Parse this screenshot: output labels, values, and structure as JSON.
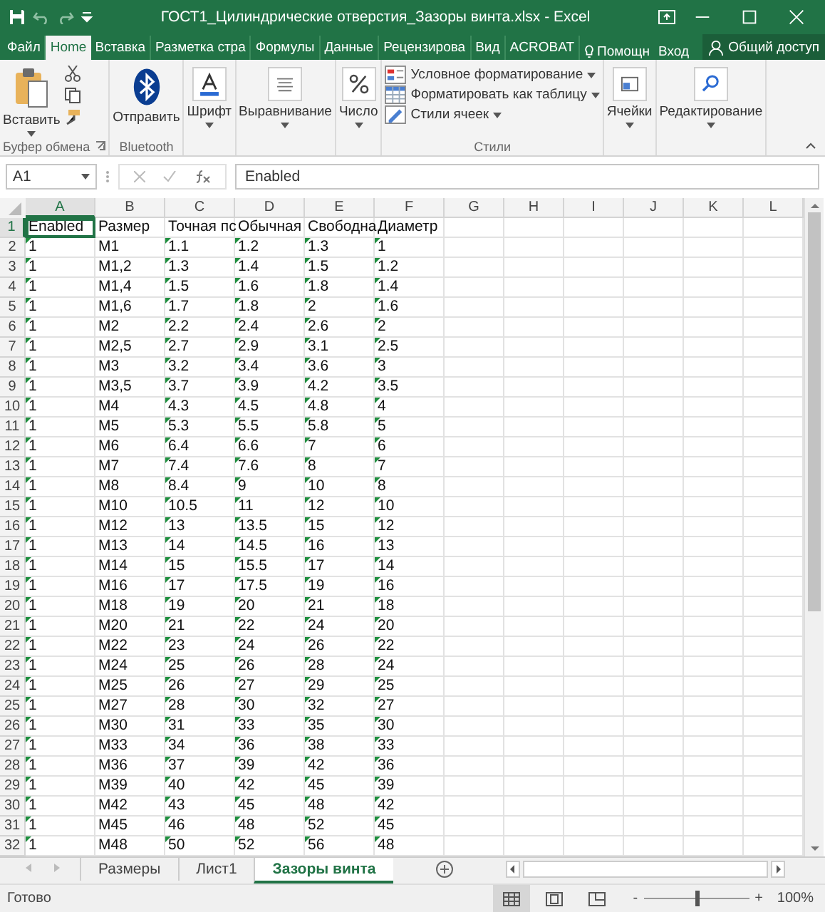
{
  "window": {
    "title": "ГОСТ1_Цилиндрические отверстия_Зазоры винта.xlsx - Excel"
  },
  "ribbon_tabs": [
    {
      "label": "Файл",
      "selected": false
    },
    {
      "label": "Home",
      "selected": true
    },
    {
      "label": "Вставка",
      "selected": false
    },
    {
      "label": "Разметка стра",
      "selected": false
    },
    {
      "label": "Формулы",
      "selected": false
    },
    {
      "label": "Данные",
      "selected": false
    },
    {
      "label": "Рецензирова",
      "selected": false
    },
    {
      "label": "Вид",
      "selected": false
    },
    {
      "label": "ACROBAT",
      "selected": false
    }
  ],
  "tell_me": "Помощн",
  "sign_in": "Вход",
  "share": "Общий доступ",
  "ribbon_groups": [
    {
      "kind": "clipboard",
      "label": "Буфер обмена",
      "buttons": [
        {
          "label": "Вставить",
          "dropdown": true
        }
      ]
    },
    {
      "kind": "bluetooth",
      "label": "Bluetooth",
      "buttons": [
        {
          "label": "Отправить",
          "dropdown": false
        }
      ]
    },
    {
      "kind": "font",
      "buttons": [
        {
          "label": "Шрифт",
          "dropdown": true
        }
      ]
    },
    {
      "kind": "alignment",
      "buttons": [
        {
          "label": "Выравнивание",
          "dropdown": true
        }
      ]
    },
    {
      "kind": "number",
      "buttons": [
        {
          "label": "Число",
          "dropdown": true
        }
      ]
    },
    {
      "kind": "styles",
      "label": "Стили",
      "buttons": [
        {
          "label": "Условное форматирование",
          "dropdown": true
        },
        {
          "label": "Форматировать как таблицу",
          "dropdown": true
        },
        {
          "label": "Стили ячеек",
          "dropdown": true
        }
      ]
    },
    {
      "kind": "cells",
      "buttons": [
        {
          "label": "Ячейки",
          "dropdown": true
        }
      ]
    },
    {
      "kind": "editing",
      "buttons": [
        {
          "label": "Редактирование",
          "dropdown": true
        }
      ]
    }
  ],
  "formula_bar": {
    "name_box": "A1",
    "formula": "Enabled"
  },
  "sheet": {
    "columns": [
      {
        "label": "A",
        "selected": true,
        "numeric_text": true
      },
      {
        "label": "B",
        "selected": false,
        "numeric_text": false
      },
      {
        "label": "C",
        "selected": false,
        "numeric_text": true
      },
      {
        "label": "D",
        "selected": false,
        "numeric_text": true
      },
      {
        "label": "E",
        "selected": false,
        "numeric_text": true
      },
      {
        "label": "F",
        "selected": false,
        "numeric_text": true
      },
      {
        "label": "G",
        "selected": false,
        "numeric_text": false
      },
      {
        "label": "H",
        "selected": false,
        "numeric_text": false
      },
      {
        "label": "I",
        "selected": false,
        "numeric_text": false
      },
      {
        "label": "J",
        "selected": false,
        "numeric_text": false
      },
      {
        "label": "K",
        "selected": false,
        "numeric_text": false
      },
      {
        "label": "L",
        "selected": false,
        "numeric_text": false
      }
    ],
    "rows": [
      {
        "number": "1",
        "selected": true,
        "flagged": false,
        "cells": [
          "Enabled",
          "Размер",
          "Точная пс",
          "Обычная",
          "Свободна",
          "Диаметр"
        ]
      },
      {
        "number": "2",
        "selected": false,
        "flagged": true,
        "cells": [
          "1",
          "M1",
          "1.1",
          "1.2",
          "1.3",
          "1"
        ]
      },
      {
        "number": "3",
        "selected": false,
        "flagged": true,
        "cells": [
          "1",
          "M1,2",
          "1.3",
          "1.4",
          "1.5",
          "1.2"
        ]
      },
      {
        "number": "4",
        "selected": false,
        "flagged": true,
        "cells": [
          "1",
          "M1,4",
          "1.5",
          "1.6",
          "1.8",
          "1.4"
        ]
      },
      {
        "number": "5",
        "selected": false,
        "flagged": true,
        "cells": [
          "1",
          "M1,6",
          "1.7",
          "1.8",
          "2",
          "1.6"
        ]
      },
      {
        "number": "6",
        "selected": false,
        "flagged": true,
        "cells": [
          "1",
          "M2",
          "2.2",
          "2.4",
          "2.6",
          "2"
        ]
      },
      {
        "number": "7",
        "selected": false,
        "flagged": true,
        "cells": [
          "1",
          "M2,5",
          "2.7",
          "2.9",
          "3.1",
          "2.5"
        ]
      },
      {
        "number": "8",
        "selected": false,
        "flagged": true,
        "cells": [
          "1",
          "M3",
          "3.2",
          "3.4",
          "3.6",
          "3"
        ]
      },
      {
        "number": "9",
        "selected": false,
        "flagged": true,
        "cells": [
          "1",
          "M3,5",
          "3.7",
          "3.9",
          "4.2",
          "3.5"
        ]
      },
      {
        "number": "10",
        "selected": false,
        "flagged": true,
        "cells": [
          "1",
          "M4",
          "4.3",
          "4.5",
          "4.8",
          "4"
        ]
      },
      {
        "number": "11",
        "selected": false,
        "flagged": true,
        "cells": [
          "1",
          "M5",
          "5.3",
          "5.5",
          "5.8",
          "5"
        ]
      },
      {
        "number": "12",
        "selected": false,
        "flagged": true,
        "cells": [
          "1",
          "M6",
          "6.4",
          "6.6",
          "7",
          "6"
        ]
      },
      {
        "number": "13",
        "selected": false,
        "flagged": true,
        "cells": [
          "1",
          "M7",
          "7.4",
          "7.6",
          "8",
          "7"
        ]
      },
      {
        "number": "14",
        "selected": false,
        "flagged": true,
        "cells": [
          "1",
          "M8",
          "8.4",
          "9",
          "10",
          "8"
        ]
      },
      {
        "number": "15",
        "selected": false,
        "flagged": true,
        "cells": [
          "1",
          "M10",
          "10.5",
          "11",
          "12",
          "10"
        ]
      },
      {
        "number": "16",
        "selected": false,
        "flagged": true,
        "cells": [
          "1",
          "M12",
          "13",
          "13.5",
          "15",
          "12"
        ]
      },
      {
        "number": "17",
        "selected": false,
        "flagged": true,
        "cells": [
          "1",
          "M13",
          "14",
          "14.5",
          "16",
          "13"
        ]
      },
      {
        "number": "18",
        "selected": false,
        "flagged": true,
        "cells": [
          "1",
          "M14",
          "15",
          "15.5",
          "17",
          "14"
        ]
      },
      {
        "number": "19",
        "selected": false,
        "flagged": true,
        "cells": [
          "1",
          "M16",
          "17",
          "17.5",
          "19",
          "16"
        ]
      },
      {
        "number": "20",
        "selected": false,
        "flagged": true,
        "cells": [
          "1",
          "M18",
          "19",
          "20",
          "21",
          "18"
        ]
      },
      {
        "number": "21",
        "selected": false,
        "flagged": true,
        "cells": [
          "1",
          "M20",
          "21",
          "22",
          "24",
          "20"
        ]
      },
      {
        "number": "22",
        "selected": false,
        "flagged": true,
        "cells": [
          "1",
          "M22",
          "23",
          "24",
          "26",
          "22"
        ]
      },
      {
        "number": "23",
        "selected": false,
        "flagged": true,
        "cells": [
          "1",
          "M24",
          "25",
          "26",
          "28",
          "24"
        ]
      },
      {
        "number": "24",
        "selected": false,
        "flagged": true,
        "cells": [
          "1",
          "M25",
          "26",
          "27",
          "29",
          "25"
        ]
      },
      {
        "number": "25",
        "selected": false,
        "flagged": true,
        "cells": [
          "1",
          "M27",
          "28",
          "30",
          "32",
          "27"
        ]
      },
      {
        "number": "26",
        "selected": false,
        "flagged": true,
        "cells": [
          "1",
          "M30",
          "31",
          "33",
          "35",
          "30"
        ]
      },
      {
        "number": "27",
        "selected": false,
        "flagged": true,
        "cells": [
          "1",
          "M33",
          "34",
          "36",
          "38",
          "33"
        ]
      },
      {
        "number": "28",
        "selected": false,
        "flagged": true,
        "cells": [
          "1",
          "M36",
          "37",
          "39",
          "42",
          "36"
        ]
      },
      {
        "number": "29",
        "selected": false,
        "flagged": true,
        "cells": [
          "1",
          "M39",
          "40",
          "42",
          "45",
          "39"
        ]
      },
      {
        "number": "30",
        "selected": false,
        "flagged": true,
        "cells": [
          "1",
          "M42",
          "43",
          "45",
          "48",
          "42"
        ]
      },
      {
        "number": "31",
        "selected": false,
        "flagged": true,
        "cells": [
          "1",
          "M45",
          "46",
          "48",
          "52",
          "45"
        ]
      },
      {
        "number": "32",
        "selected": false,
        "flagged": true,
        "cells": [
          "1",
          "M48",
          "50",
          "52",
          "56",
          "48"
        ]
      }
    ]
  },
  "sheet_tabs": [
    {
      "label": "Размеры",
      "selected": false
    },
    {
      "label": "Лист1",
      "selected": false
    },
    {
      "label": "Зазоры винта",
      "selected": true
    }
  ],
  "status_bar": {
    "status": "Готово",
    "views": [
      {
        "kind": "normal",
        "selected": true
      },
      {
        "kind": "page-layout",
        "selected": false
      },
      {
        "kind": "page-break",
        "selected": false
      }
    ],
    "zoom_minus": "-",
    "zoom_plus": "+",
    "zoom": {
      "level": 0.5
    },
    "zoom_reading": "100%"
  }
}
